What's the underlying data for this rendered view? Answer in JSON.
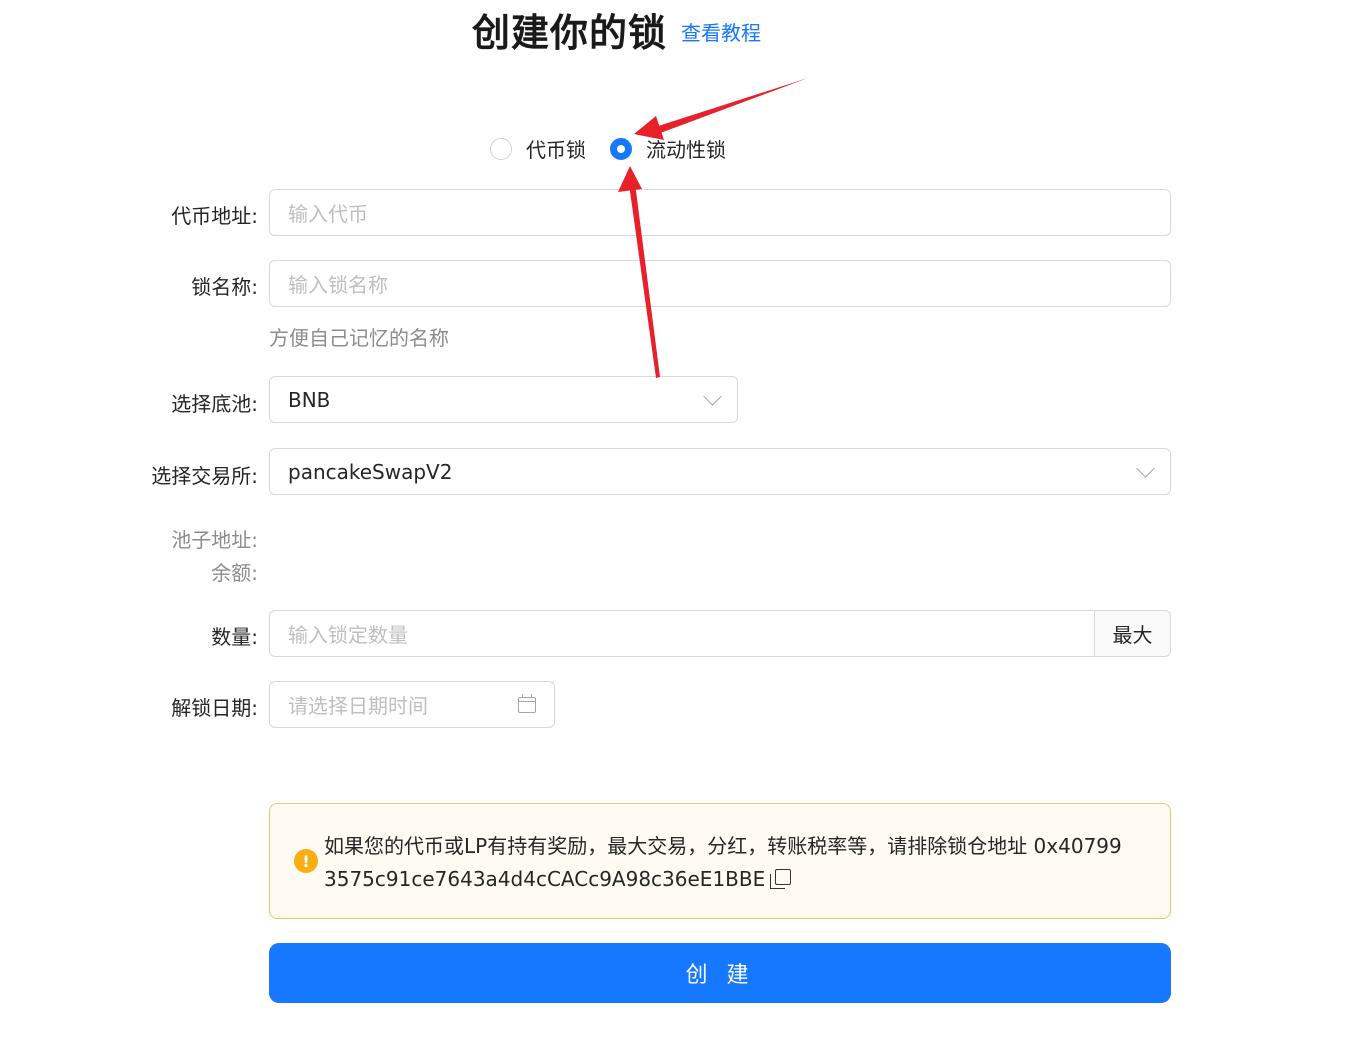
{
  "header": {
    "title": "创建你的锁",
    "tutorial_link": "查看教程"
  },
  "lock_type": {
    "options": [
      {
        "label": "代币锁",
        "selected": false
      },
      {
        "label": "流动性锁",
        "selected": true
      }
    ]
  },
  "form": {
    "token_address": {
      "label": "代币地址:",
      "placeholder": "输入代币"
    },
    "lock_name": {
      "label": "锁名称:",
      "placeholder": "输入锁名称",
      "hint": "方便自己记忆的名称"
    },
    "base_pool": {
      "label": "选择底池:",
      "value": "BNB"
    },
    "exchange": {
      "label": "选择交易所:",
      "value": "pancakeSwapV2"
    },
    "pool_address": {
      "label": "池子地址:"
    },
    "balance": {
      "label": "余额:"
    },
    "amount": {
      "label": "数量:",
      "placeholder": "输入锁定数量",
      "max_label": "最大"
    },
    "unlock_date": {
      "label": "解锁日期:",
      "placeholder": "请选择日期时间"
    }
  },
  "alert": {
    "line1": "如果您的代币或LP有持有奖励，最大交易，分红，转账税率等，请排除锁仓地址 0x40799",
    "line2": "3575c91ce7643a4d4cCACc9A98c36eE1BBE"
  },
  "submit_label": "创 建",
  "colors": {
    "primary": "#1677ff",
    "warning": "#faad14",
    "annotation_arrow": "#e8202a"
  }
}
